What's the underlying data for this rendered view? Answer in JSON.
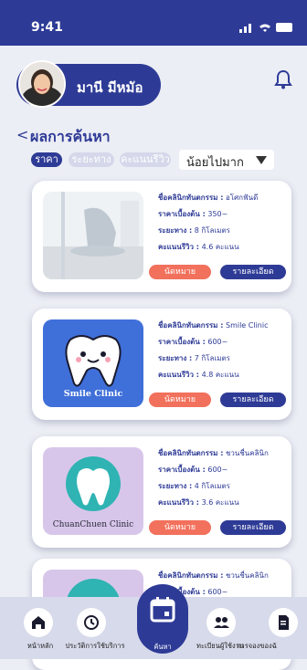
{
  "status": {
    "time": "9:41"
  },
  "user": {
    "name": "มานี มีหมัอ"
  },
  "header": {
    "back": "<",
    "title": "ผลการค้นหา"
  },
  "filters": {
    "chips": [
      "ราคา",
      "ระยะทาง",
      "คะแนนรีวิว"
    ],
    "sort_value": "น้อยไปมาก"
  },
  "labels": {
    "clinic_name": "ชื่อคลินิกทันตกรรม :",
    "price": "ราคาเบื้องต้น :",
    "distance": "ระยะทาง :",
    "rating": "คะแนนรีวิว :",
    "appointment": "นัดหมาย",
    "details": "รายละเอียด"
  },
  "clinics": [
    {
      "name": "อโศกฟันดี",
      "price": "350~",
      "distance": "8 กิโลเมตร",
      "rating": "4.6 คะแนน",
      "image_text": ""
    },
    {
      "name": "Smile Clinic",
      "price": "600~",
      "distance": "7 กิโลเมตร",
      "rating": "4.8 คะแนน",
      "image_text": "Smile Clinic"
    },
    {
      "name": "ชวนชื่นคลินิก",
      "price": "600~",
      "distance": "4 กิโลเมตร",
      "rating": "3.6 คะแนน",
      "image_text": "ChuanChuen Clinic"
    },
    {
      "name": "ชวนชื่นคลินิก",
      "price": "600~",
      "distance": "",
      "rating": "",
      "image_text": ""
    }
  ],
  "nav": {
    "home": "หน้าหลัก",
    "history": "ประวัติการใช้บริการ",
    "search": "ค้นหา",
    "users": "ทะเบียนผู้ใช้งาน",
    "bookings": "การจองของฉั"
  },
  "colors": {
    "primary": "#2e3b96",
    "accent": "#f2715c",
    "background": "#eceef5"
  }
}
